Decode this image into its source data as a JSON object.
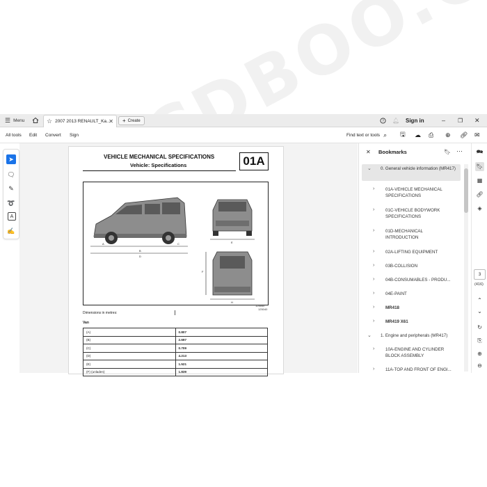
{
  "tabbar": {
    "menu_label": "Menu",
    "tab_title": "2007 2013 RENAULT_Ka...",
    "create_label": "Create",
    "signin_label": "Sign in"
  },
  "menubar": {
    "all_tools": "All tools",
    "edit": "Edit",
    "convert": "Convert",
    "sign": "Sign",
    "find": "Find text or tools"
  },
  "document": {
    "heading1": "VEHICLE MECHANICAL SPECIFICATIONS",
    "heading2": "Vehicle: Specifications",
    "section_code": "01A",
    "fig_ref1": "125540",
    "fig_ref2": "125040",
    "dimensions_caption": "Dimensions in metres:",
    "table_label": "Van",
    "rows": [
      {
        "label": "(A)",
        "value": "0.807"
      },
      {
        "label": "(B)",
        "value": "2.697"
      },
      {
        "label": "(C)",
        "value": "0.709"
      },
      {
        "label": "(D)",
        "value": "4.213"
      },
      {
        "label": "(E)",
        "value": "1.521"
      },
      {
        "label": "(F) (unladen)",
        "value": "1.839"
      }
    ]
  },
  "bookmarks": {
    "title": "Bookmarks",
    "items": [
      {
        "label": "0. General vehicle information (MR417)",
        "chevron": "down",
        "selected": true
      },
      {
        "label": "01A-VEHICLE MECHANICAL SPECIFICATIONS",
        "chevron": "right"
      },
      {
        "label": "01C-VEHICLE BODYWORK SPECIFICATIONS",
        "chevron": "right"
      },
      {
        "label": "01D-MECHANICAL INTRODUCTION",
        "chevron": "right"
      },
      {
        "label": "02A-LIFTING EQUIPMENT",
        "chevron": "right"
      },
      {
        "label": "03B-COLLISION",
        "chevron": "right"
      },
      {
        "label": "04B-CONSUMABLES - PRODU...",
        "chevron": "right"
      },
      {
        "label": "04E-PAINT",
        "chevron": "right"
      },
      {
        "label": "MR418",
        "chevron": "right",
        "bold": true
      },
      {
        "label": "MR419 X61",
        "chevron": "right",
        "bold": true
      },
      {
        "label": "1. Engine and peripherals (MR417)",
        "chevron": "down"
      },
      {
        "label": "10A-ENGINE AND CYLINDER BLOCK ASSEMBLY",
        "chevron": "right"
      },
      {
        "label": "11A-TOP AND FRONT OF ENGI...",
        "chevron": "right"
      }
    ]
  },
  "rightrail": {
    "page_number": "3",
    "page_total": "(416)"
  },
  "watermark": "EPCDBOO.COM",
  "colors": {
    "accent": "#1a73e8",
    "selected_bg": "#e6e6e6",
    "chrome_bg": "#ececec"
  }
}
